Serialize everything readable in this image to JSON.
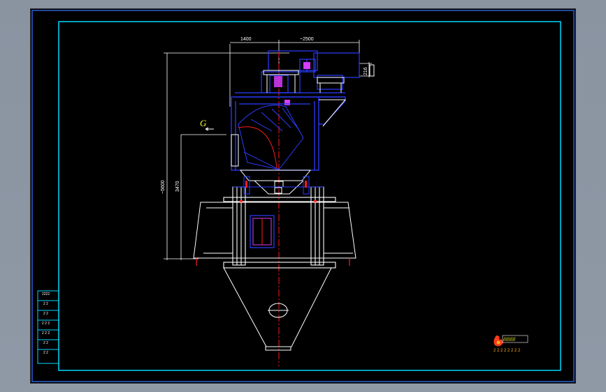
{
  "colors": {
    "background": "#000000",
    "border_outer": "#2f5fd8",
    "border_inner": "#00d8ff",
    "outline": "#ffffff",
    "equipment": "#2b3cff",
    "centerline": "#ff1a1a",
    "label": "#ffff33",
    "accent": "#ffb020"
  },
  "dimensions": {
    "top_left": "1400",
    "top_right": "~2500",
    "overall_height": "~5600",
    "inlet_height": "3470",
    "motor_size": "216"
  },
  "labels": {
    "view_marker": "G"
  },
  "title_block": {
    "rows": [
      "2222",
      "2 2",
      "2 2",
      "2 2 2",
      "2 2 2",
      "2 2",
      "2 2"
    ],
    "logo_caption": "2 2 2 2 2 2 2 2",
    "logo_hatch": "/////////"
  }
}
